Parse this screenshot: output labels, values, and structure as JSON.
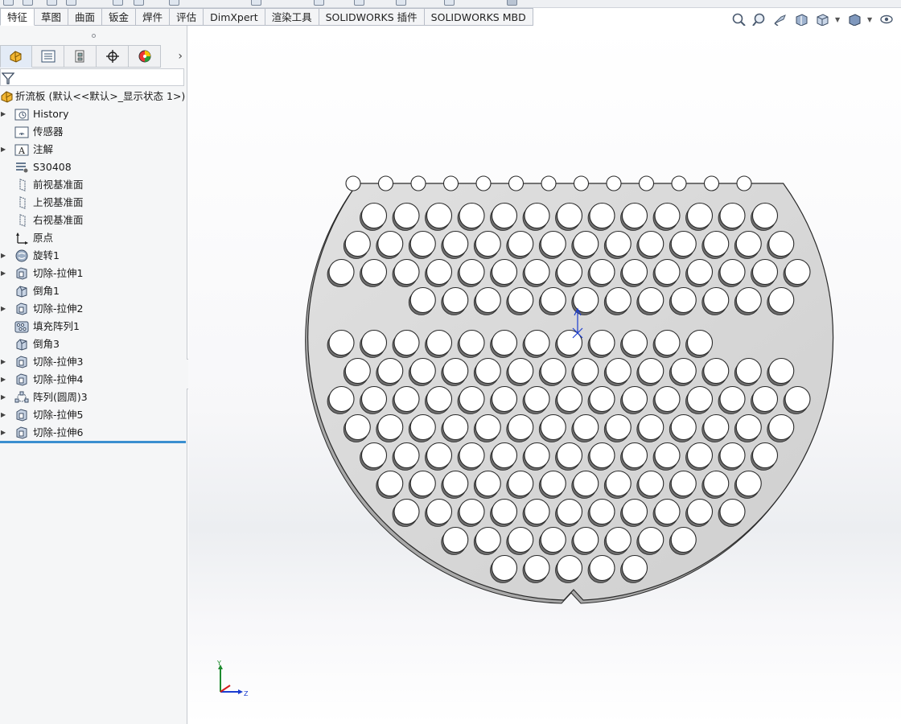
{
  "command_tabs": [
    {
      "label": "特征",
      "active": true
    },
    {
      "label": "草图"
    },
    {
      "label": "曲面"
    },
    {
      "label": "钣金"
    },
    {
      "label": "焊件"
    },
    {
      "label": "评估"
    },
    {
      "label": "DimXpert"
    },
    {
      "label": "渲染工具"
    },
    {
      "label": "SOLIDWORKS 插件"
    },
    {
      "label": "SOLIDWORKS MBD"
    }
  ],
  "view_toolbar": [
    "zoom-to-fit-icon",
    "zoom-to-area-icon",
    "previous-view-icon",
    "section-view-icon",
    "view-orientation-icon",
    "display-style-icon",
    "hide-show-items-icon"
  ],
  "panel_tabs": [
    "feature-manager-icon",
    "property-manager-icon",
    "configuration-manager-icon",
    "dimxpert-manager-icon",
    "display-manager-icon"
  ],
  "feature_tree": {
    "root": "折流板 (默认<<默认>_显示状态 1>)",
    "items": [
      {
        "label": "History",
        "icon": "history-folder-icon",
        "expandable": true
      },
      {
        "label": "传感器",
        "icon": "sensors-folder-icon",
        "expandable": false
      },
      {
        "label": "注解",
        "icon": "annotations-icon",
        "expandable": true
      },
      {
        "label": "S30408",
        "icon": "material-icon",
        "expandable": false
      },
      {
        "label": "前视基准面",
        "icon": "plane-icon",
        "expandable": false
      },
      {
        "label": "上视基准面",
        "icon": "plane-icon",
        "expandable": false
      },
      {
        "label": "右视基准面",
        "icon": "plane-icon",
        "expandable": false
      },
      {
        "label": "原点",
        "icon": "origin-icon",
        "expandable": false
      },
      {
        "label": "旋转1",
        "icon": "revolve-icon",
        "expandable": true
      },
      {
        "label": "切除-拉伸1",
        "icon": "cut-extrude-icon",
        "expandable": true
      },
      {
        "label": "倒角1",
        "icon": "chamfer-icon",
        "expandable": false
      },
      {
        "label": "切除-拉伸2",
        "icon": "cut-extrude-icon",
        "expandable": true
      },
      {
        "label": "填充阵列1",
        "icon": "fill-pattern-icon",
        "expandable": false
      },
      {
        "label": "倒角3",
        "icon": "chamfer-icon",
        "expandable": false
      },
      {
        "label": "切除-拉伸3",
        "icon": "cut-extrude-icon",
        "expandable": true
      },
      {
        "label": "切除-拉伸4",
        "icon": "cut-extrude-icon",
        "expandable": true
      },
      {
        "label": "阵列(圆周)3",
        "icon": "circular-pattern-icon",
        "expandable": true
      },
      {
        "label": "切除-拉伸5",
        "icon": "cut-extrude-icon",
        "expandable": true
      },
      {
        "label": "切除-拉伸6",
        "icon": "cut-extrude-icon",
        "expandable": true
      }
    ]
  },
  "triad": {
    "y": "Y",
    "z": "Z"
  },
  "colors": {
    "accent": "#3a8fd0",
    "part": "#d6d6d6",
    "edge": "#2a2a2a"
  }
}
